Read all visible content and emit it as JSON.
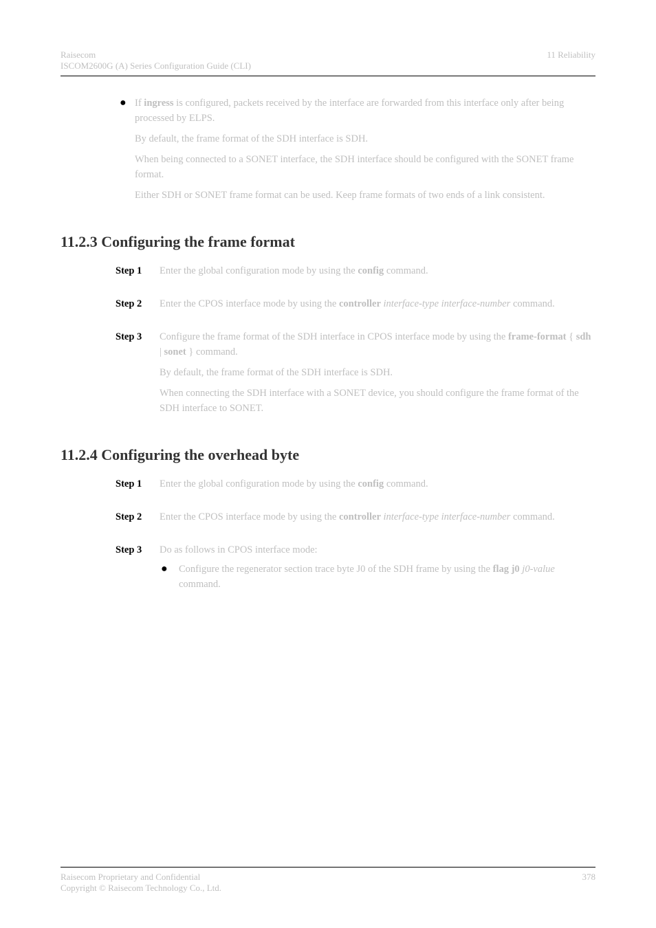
{
  "header": {
    "left_line1": "Raisecom",
    "left_line2": "ISCOM2600G (A) Series Configuration Guide (CLI)",
    "right_line1": "11 Reliability"
  },
  "top_bullet": {
    "pre": "If ",
    "cmd": "ingress",
    "post": " is configured, packets received by the interface are forwarded from this interface only after being processed by ELPS."
  },
  "paragraph_a": "By default, the frame format of the SDH interface is SDH.",
  "paragraph_b": "When being connected to a SONET interface, the SDH interface should be configured with the SONET frame format.",
  "paragraph_c": "Either SDH or SONET frame format can be used. Keep frame formats of two ends of a link consistent.",
  "section_1": {
    "heading": "11.2.3 Configuring the frame format",
    "steps": [
      {
        "label": "Step 1",
        "text": "Enter the global configuration mode by using the ",
        "cmd": "config",
        "tail": " command."
      },
      {
        "label": "Step 2",
        "pre": "Enter the CPOS interface mode by using the ",
        "cmd": "controller",
        "italic": " interface-type interface-number",
        "tail": " command."
      },
      {
        "label": "Step 3",
        "pre": "Configure the frame format of the SDH interface in CPOS interface mode by using the ",
        "cmd": "frame-format",
        "mid": " { ",
        "cmd2": "sdh",
        "mid2": " | ",
        "cmd3": "sonet",
        "tail": " } command."
      }
    ],
    "para_after_1": "By default, the frame format of the SDH interface is SDH.",
    "para_after_2": "When connecting the SDH interface with a SONET device, you should configure the frame format of the SDH interface to SONET."
  },
  "section_2": {
    "heading": "11.2.4 Configuring the overhead byte",
    "steps": [
      {
        "label": "Step 1",
        "text": "Enter the global configuration mode by using the ",
        "cmd": "config",
        "tail": " command."
      },
      {
        "label": "Step 2",
        "pre": "Enter the CPOS interface mode by using the ",
        "cmd": "controller",
        "italic": " interface-type interface-number",
        "tail": " command."
      },
      {
        "label": "Step 3",
        "text": "Do as follows in CPOS interface mode:"
      }
    ],
    "sub_bullet": {
      "pre": "Configure the regenerator section trace byte J0 of the SDH frame by using the ",
      "cmd": "flag j0",
      "italic": " j0-value",
      "tail": " command."
    }
  },
  "footer": {
    "left_line1": "Raisecom Proprietary and Confidential",
    "left_line2": "Copyright © Raisecom Technology Co., Ltd.",
    "right": "378"
  }
}
